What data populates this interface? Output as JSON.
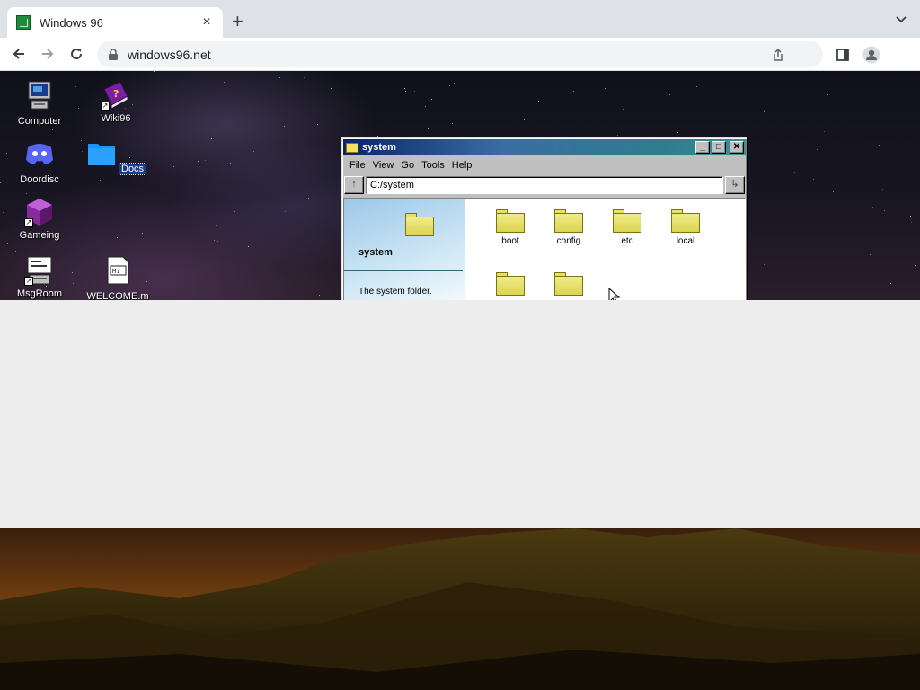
{
  "browser": {
    "tab_title": "Windows 96",
    "tab_close": "×",
    "new_tab": "+",
    "url": "windows96.net"
  },
  "desktop": {
    "icons": [
      {
        "label": "Computer",
        "icon": "computer-icon"
      },
      {
        "label": "Wiki96",
        "icon": "wiki-book-icon"
      },
      {
        "label": "Doordisc",
        "icon": "discord-icon"
      },
      {
        "label": "Docs",
        "icon": "folder-icon",
        "selected": true
      },
      {
        "label": "Gameing",
        "icon": "game-cube-icon"
      },
      {
        "label": "MsgRoom",
        "icon": "msgroom-icon"
      },
      {
        "label": "WELCOME.m",
        "icon": "markdown-file-icon"
      }
    ]
  },
  "explorer": {
    "title": "system",
    "menu": [
      "File",
      "View",
      "Go",
      "Tools",
      "Help"
    ],
    "up_label": "↑",
    "go_label": "↳",
    "path": "C:/system",
    "side_title": "system",
    "side_desc": "The system folder.",
    "folders": [
      "boot",
      "config",
      "etc",
      "local",
      "",
      ""
    ],
    "minimize": "_",
    "maximize": "□",
    "close": "✕"
  },
  "colors": {
    "titlebar_start": "#0a246a",
    "titlebar_end": "#3a8f9a",
    "folder_yellow": "#f0ec8a",
    "selection": "#1a3a8c"
  }
}
